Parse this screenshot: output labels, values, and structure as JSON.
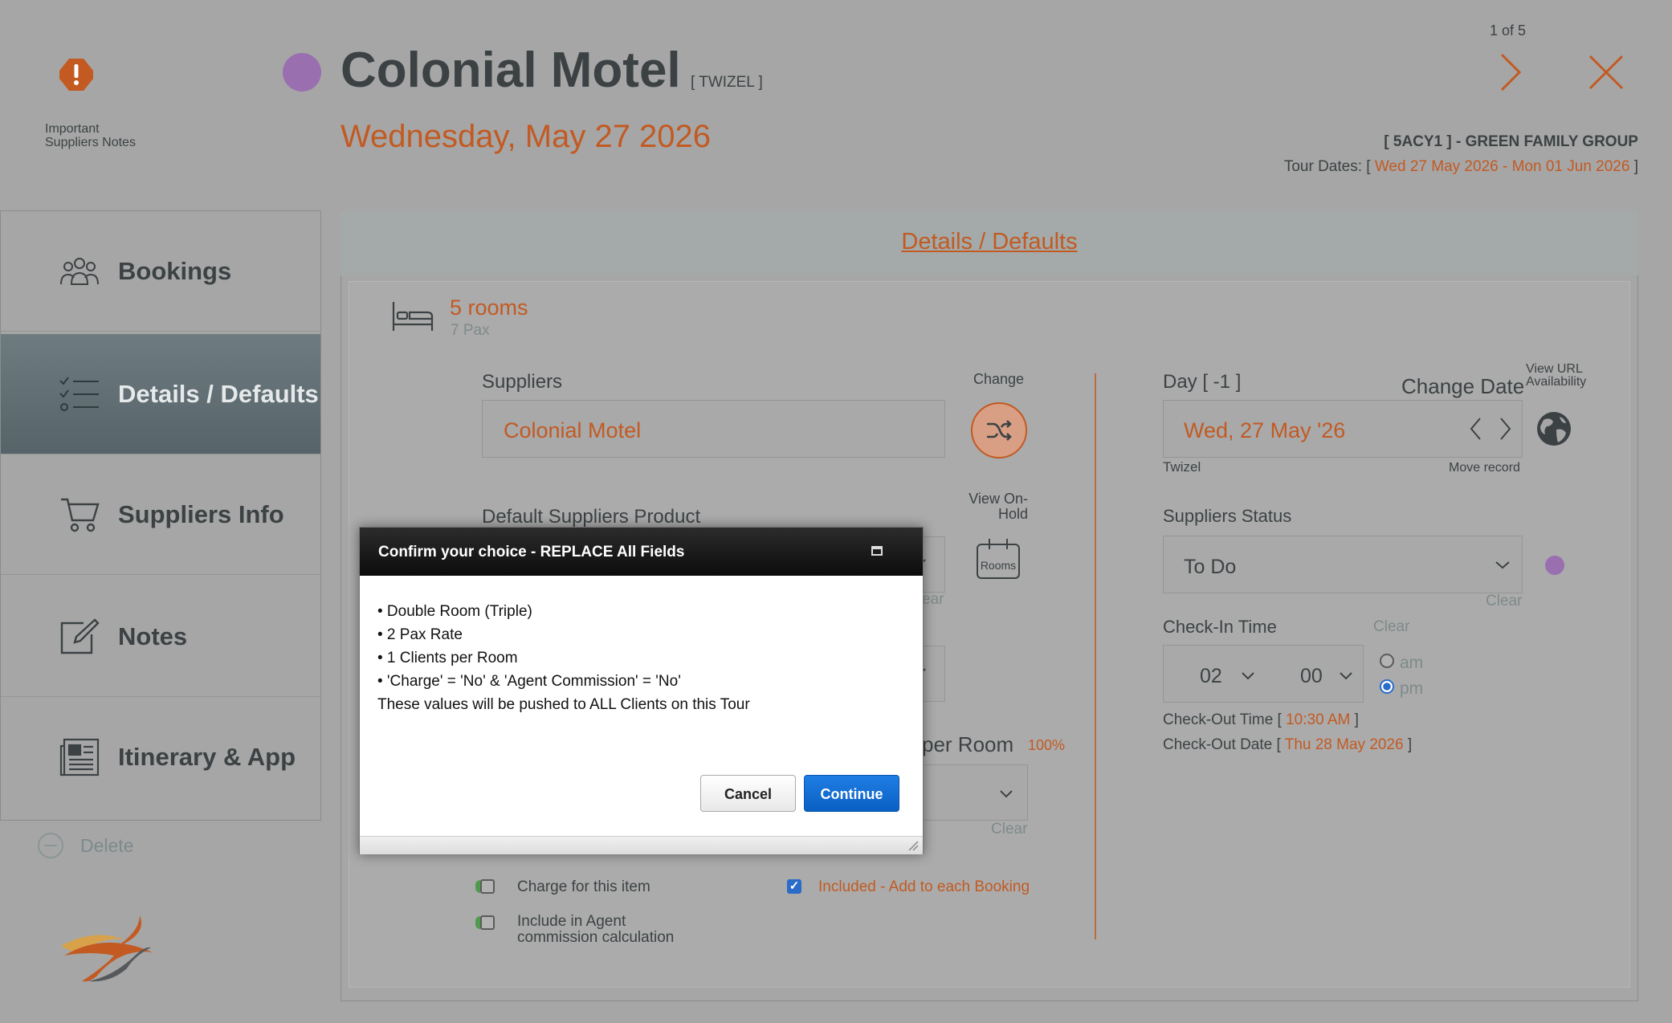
{
  "header": {
    "important_notes": "Important Suppliers Notes",
    "title": "Colonial Motel",
    "location": "[ TWIZEL ]",
    "date": "Wednesday, May 27 2026",
    "pager": "1 of 5",
    "group": "[ 5ACY1 ] - GREEN FAMILY GROUP",
    "tour_dates_label": "Tour Dates: [",
    "tour_start": "Wed 27 May 2026",
    "tour_sep": "-",
    "tour_end": "Mon 01 Jun 2026",
    "tour_close": "]"
  },
  "sidebar": {
    "items": [
      {
        "label": "Bookings",
        "icon": "people-icon"
      },
      {
        "label": "Details / Defaults",
        "icon": "checklist-icon"
      },
      {
        "label": "Suppliers Info",
        "icon": "cart-icon"
      },
      {
        "label": "Notes",
        "icon": "edit-note-icon"
      },
      {
        "label": "Itinerary & App",
        "icon": "newspaper-icon"
      }
    ],
    "active": "Details / Defaults",
    "delete_label": "Delete"
  },
  "panel": {
    "tab_label": "Details / Defaults",
    "rooms": "5 rooms",
    "pax": "7 Pax",
    "suppliers_label": "Suppliers",
    "change_label": "Change",
    "supplier_value": "Colonial Motel",
    "default_product_label": "Default Suppliers Product",
    "view_onhold_label": "View On-Hold",
    "rooms_icon_label": "Rooms",
    "clear_partial": "ear",
    "per_room_label": "per Room",
    "per_room_pct": "100%",
    "clear": "Clear",
    "charge_label": "Charge for this item",
    "agent_label": "Include in Agent commission calculation",
    "included_label": "Included - Add to each Booking",
    "included_checked": true,
    "day_label": "Day [ -1 ]",
    "change_date_label": "Change Date",
    "view_url_label": "View URL Availability",
    "date_value": "Wed, 27 May '26",
    "town": "Twizel",
    "move_record": "Move record",
    "status_label": "Suppliers Status",
    "status_value": "To Do",
    "checkin_label": "Check-In Time",
    "checkin_hour": "02",
    "checkin_min": "00",
    "am": "am",
    "pm": "pm",
    "pm_selected": true,
    "checkout_time_label": "Check-Out Time [",
    "checkout_time": "10:30 AM",
    "checkout_date_label": "Check-Out Date [",
    "checkout_date": "Thu 28 May 2026",
    "bracket_close": "]"
  },
  "modal": {
    "title": "Confirm your choice - REPLACE All Fields",
    "lines": [
      "• Double Room (Triple)",
      "• 2 Pax Rate",
      "• 1 Clients per Room",
      "• 'Charge' = 'No' & 'Agent Commission' = 'No'",
      "These values will be pushed to ALL Clients on this Tour"
    ],
    "cancel_label": "Cancel",
    "continue_label": "Continue"
  },
  "colors": {
    "accent": "#c25a22",
    "status_dot": "#9a6fb0",
    "primary_button": "#0a5fc3"
  }
}
